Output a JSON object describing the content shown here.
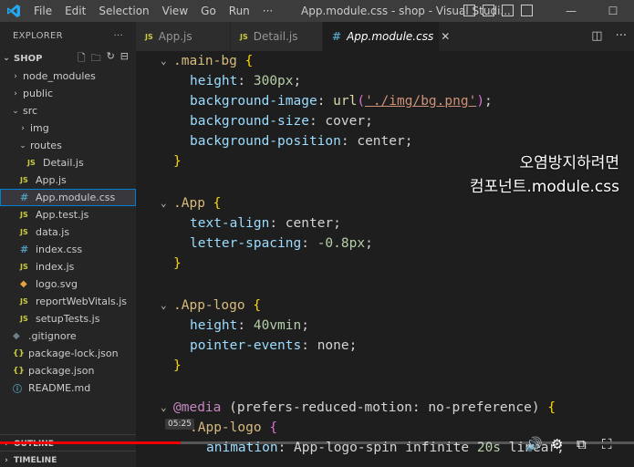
{
  "titlebar": {
    "menu": [
      "File",
      "Edit",
      "Selection",
      "View",
      "Go",
      "Run",
      "···"
    ],
    "window_title": "App.module.css - shop - Visual Studi...",
    "controls": [
      "—",
      "☐"
    ]
  },
  "sidebar": {
    "header": "EXPLORER",
    "header_more": "···",
    "project": "SHOP",
    "tree": [
      {
        "label": "node_modules",
        "type": "folder",
        "expanded": false,
        "depth": 1
      },
      {
        "label": "public",
        "type": "folder",
        "expanded": false,
        "depth": 1
      },
      {
        "label": "src",
        "type": "folder",
        "expanded": true,
        "depth": 1
      },
      {
        "label": "img",
        "type": "folder",
        "expanded": false,
        "depth": 2
      },
      {
        "label": "routes",
        "type": "folder",
        "expanded": true,
        "depth": 2
      },
      {
        "label": "Detail.js",
        "type": "js",
        "depth": 3
      },
      {
        "label": "App.js",
        "type": "js",
        "depth": 2
      },
      {
        "label": "App.module.css",
        "type": "css",
        "depth": 2,
        "selected": true
      },
      {
        "label": "App.test.js",
        "type": "js",
        "depth": 2
      },
      {
        "label": "data.js",
        "type": "js",
        "depth": 2
      },
      {
        "label": "index.css",
        "type": "css",
        "depth": 2
      },
      {
        "label": "index.js",
        "type": "js",
        "depth": 2
      },
      {
        "label": "logo.svg",
        "type": "svg",
        "depth": 2
      },
      {
        "label": "reportWebVitals.js",
        "type": "js",
        "depth": 2
      },
      {
        "label": "setupTests.js",
        "type": "js",
        "depth": 2
      },
      {
        "label": ".gitignore",
        "type": "git",
        "depth": 1
      },
      {
        "label": "package-lock.json",
        "type": "json",
        "depth": 1
      },
      {
        "label": "package.json",
        "type": "json",
        "depth": 1
      },
      {
        "label": "README.md",
        "type": "info",
        "depth": 1
      }
    ],
    "outline": "OUTLINE",
    "timeline": "TIMELINE"
  },
  "tabs": [
    {
      "label": "App.js",
      "type": "js",
      "active": false
    },
    {
      "label": "Detail.js",
      "type": "js",
      "active": false
    },
    {
      "label": "App.module.css",
      "type": "css",
      "active": true
    }
  ],
  "code": {
    "l1_sel": ".main-bg",
    "l2_prop": "height",
    "l2_val": "300px",
    "l3_prop": "background-image",
    "l3_fn": "url",
    "l3_str": "'./img/bg.png'",
    "l4_prop": "background-size",
    "l4_val": "cover",
    "l5_prop": "background-position",
    "l5_val": "center",
    "l7_sel": ".App",
    "l8_prop": "text-align",
    "l8_val": "center",
    "l9_prop": "letter-spacing",
    "l9_val": "-0.8px",
    "l11_sel": ".App-logo",
    "l12_prop": "height",
    "l12_val": "40vmin",
    "l13_prop": "pointer-events",
    "l13_val": "none",
    "l15_kw": "@media",
    "l15_rest": " (prefers-reduced-motion: no-preference) ",
    "l16_sel": ".App-logo",
    "l17_prop": "animation",
    "l17_val1": "App-logo-spin infinite ",
    "l17_num": "20s",
    "l17_val2": " linear;"
  },
  "caption": {
    "line1": "오염방지하려면",
    "line2": "컴포넌트.module.css"
  },
  "video": {
    "timestamp": "05:25",
    "progress": 0.285
  },
  "colors": {
    "accent": "#007fd4",
    "progress": "#ee0000"
  }
}
